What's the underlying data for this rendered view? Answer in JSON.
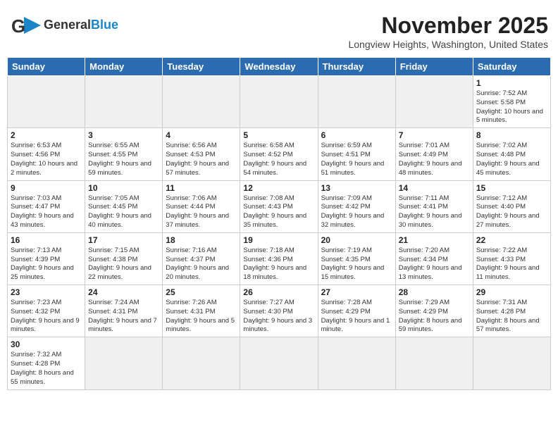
{
  "header": {
    "logo_general": "General",
    "logo_blue": "Blue",
    "title": "November 2025",
    "subtitle": "Longview Heights, Washington, United States"
  },
  "weekdays": [
    "Sunday",
    "Monday",
    "Tuesday",
    "Wednesday",
    "Thursday",
    "Friday",
    "Saturday"
  ],
  "weeks": [
    [
      {
        "day": "",
        "info": ""
      },
      {
        "day": "",
        "info": ""
      },
      {
        "day": "",
        "info": ""
      },
      {
        "day": "",
        "info": ""
      },
      {
        "day": "",
        "info": ""
      },
      {
        "day": "",
        "info": ""
      },
      {
        "day": "1",
        "info": "Sunrise: 7:52 AM\nSunset: 5:58 PM\nDaylight: 10 hours and 5 minutes."
      }
    ],
    [
      {
        "day": "2",
        "info": "Sunrise: 6:53 AM\nSunset: 4:56 PM\nDaylight: 10 hours and 2 minutes."
      },
      {
        "day": "3",
        "info": "Sunrise: 6:55 AM\nSunset: 4:55 PM\nDaylight: 9 hours and 59 minutes."
      },
      {
        "day": "4",
        "info": "Sunrise: 6:56 AM\nSunset: 4:53 PM\nDaylight: 9 hours and 57 minutes."
      },
      {
        "day": "5",
        "info": "Sunrise: 6:58 AM\nSunset: 4:52 PM\nDaylight: 9 hours and 54 minutes."
      },
      {
        "day": "6",
        "info": "Sunrise: 6:59 AM\nSunset: 4:51 PM\nDaylight: 9 hours and 51 minutes."
      },
      {
        "day": "7",
        "info": "Sunrise: 7:01 AM\nSunset: 4:49 PM\nDaylight: 9 hours and 48 minutes."
      },
      {
        "day": "8",
        "info": "Sunrise: 7:02 AM\nSunset: 4:48 PM\nDaylight: 9 hours and 45 minutes."
      }
    ],
    [
      {
        "day": "9",
        "info": "Sunrise: 7:03 AM\nSunset: 4:47 PM\nDaylight: 9 hours and 43 minutes."
      },
      {
        "day": "10",
        "info": "Sunrise: 7:05 AM\nSunset: 4:45 PM\nDaylight: 9 hours and 40 minutes."
      },
      {
        "day": "11",
        "info": "Sunrise: 7:06 AM\nSunset: 4:44 PM\nDaylight: 9 hours and 37 minutes."
      },
      {
        "day": "12",
        "info": "Sunrise: 7:08 AM\nSunset: 4:43 PM\nDaylight: 9 hours and 35 minutes."
      },
      {
        "day": "13",
        "info": "Sunrise: 7:09 AM\nSunset: 4:42 PM\nDaylight: 9 hours and 32 minutes."
      },
      {
        "day": "14",
        "info": "Sunrise: 7:11 AM\nSunset: 4:41 PM\nDaylight: 9 hours and 30 minutes."
      },
      {
        "day": "15",
        "info": "Sunrise: 7:12 AM\nSunset: 4:40 PM\nDaylight: 9 hours and 27 minutes."
      }
    ],
    [
      {
        "day": "16",
        "info": "Sunrise: 7:13 AM\nSunset: 4:39 PM\nDaylight: 9 hours and 25 minutes."
      },
      {
        "day": "17",
        "info": "Sunrise: 7:15 AM\nSunset: 4:38 PM\nDaylight: 9 hours and 22 minutes."
      },
      {
        "day": "18",
        "info": "Sunrise: 7:16 AM\nSunset: 4:37 PM\nDaylight: 9 hours and 20 minutes."
      },
      {
        "day": "19",
        "info": "Sunrise: 7:18 AM\nSunset: 4:36 PM\nDaylight: 9 hours and 18 minutes."
      },
      {
        "day": "20",
        "info": "Sunrise: 7:19 AM\nSunset: 4:35 PM\nDaylight: 9 hours and 15 minutes."
      },
      {
        "day": "21",
        "info": "Sunrise: 7:20 AM\nSunset: 4:34 PM\nDaylight: 9 hours and 13 minutes."
      },
      {
        "day": "22",
        "info": "Sunrise: 7:22 AM\nSunset: 4:33 PM\nDaylight: 9 hours and 11 minutes."
      }
    ],
    [
      {
        "day": "23",
        "info": "Sunrise: 7:23 AM\nSunset: 4:32 PM\nDaylight: 9 hours and 9 minutes."
      },
      {
        "day": "24",
        "info": "Sunrise: 7:24 AM\nSunset: 4:31 PM\nDaylight: 9 hours and 7 minutes."
      },
      {
        "day": "25",
        "info": "Sunrise: 7:26 AM\nSunset: 4:31 PM\nDaylight: 9 hours and 5 minutes."
      },
      {
        "day": "26",
        "info": "Sunrise: 7:27 AM\nSunset: 4:30 PM\nDaylight: 9 hours and 3 minutes."
      },
      {
        "day": "27",
        "info": "Sunrise: 7:28 AM\nSunset: 4:29 PM\nDaylight: 9 hours and 1 minute."
      },
      {
        "day": "28",
        "info": "Sunrise: 7:29 AM\nSunset: 4:29 PM\nDaylight: 8 hours and 59 minutes."
      },
      {
        "day": "29",
        "info": "Sunrise: 7:31 AM\nSunset: 4:28 PM\nDaylight: 8 hours and 57 minutes."
      }
    ],
    [
      {
        "day": "30",
        "info": "Sunrise: 7:32 AM\nSunset: 4:28 PM\nDaylight: 8 hours and 55 minutes."
      },
      {
        "day": "",
        "info": ""
      },
      {
        "day": "",
        "info": ""
      },
      {
        "day": "",
        "info": ""
      },
      {
        "day": "",
        "info": ""
      },
      {
        "day": "",
        "info": ""
      },
      {
        "day": "",
        "info": ""
      }
    ]
  ]
}
